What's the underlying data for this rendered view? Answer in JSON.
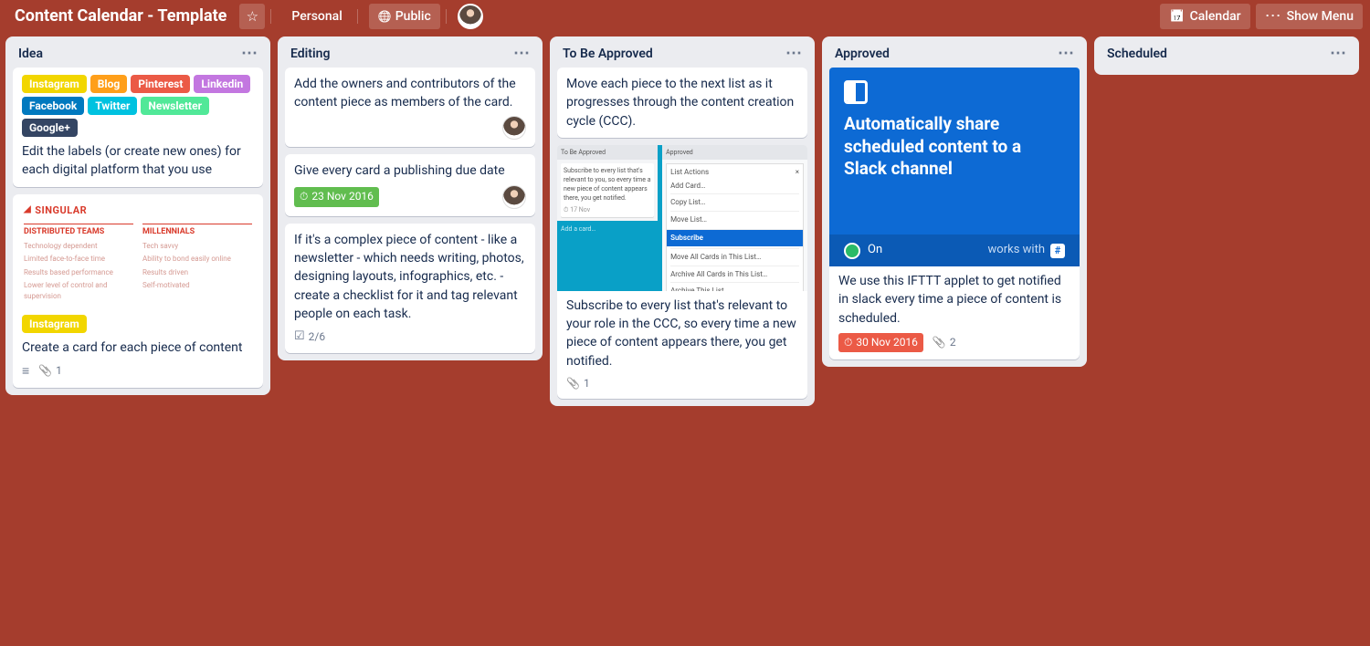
{
  "header": {
    "board_title": "Content Calendar - Template",
    "personal": "Personal",
    "public": "Public",
    "calendar": "Calendar",
    "show_menu": "Show Menu"
  },
  "label_colors": {
    "Instagram": "#f2d600",
    "Blog": "#ff9f1a",
    "Pinterest": "#eb5a46",
    "Linkedin": "#c377e0",
    "Facebook": "#0079bf",
    "Twitter": "#00c2e0",
    "Newsletter": "#51e898",
    "Google+": "#344563"
  },
  "lists": {
    "idea": {
      "title": "Idea",
      "card1": {
        "labels": [
          "Instagram",
          "Blog",
          "Pinterest",
          "Linkedin",
          "Facebook",
          "Twitter",
          "Newsletter",
          "Google+"
        ],
        "text": "Edit the labels (or create new ones) for each digital platform that you use"
      },
      "card2": {
        "cover": {
          "brand": "SINGULAR",
          "col1_head": "DISTRIBUTED TEAMS",
          "col1_lines": [
            "Technology dependent",
            "Limited face-to-face time",
            "Results based performance",
            "Lower level of control and supervision"
          ],
          "col2_head": "MILLENNIALS",
          "col2_lines": [
            "Tech savvy",
            "Ability to bond easily online",
            "Results driven",
            "Self-motivated"
          ]
        },
        "labels": [
          "Instagram"
        ],
        "text": "Create a card for each piece of content",
        "attach_count": "1"
      }
    },
    "editing": {
      "title": "Editing",
      "card1": {
        "text": "Add the owners and contributors of the content piece as members of the card."
      },
      "card2": {
        "text": "Give every card a publishing due date",
        "due": "23 Nov 2016"
      },
      "card3": {
        "text": "If it's a complex piece of content - like a newsletter - which needs writing, photos, designing layouts, infographics, etc. - create a checklist for it and tag relevant people on each task.",
        "checklist": "2/6"
      }
    },
    "tba": {
      "title": "To Be Approved",
      "card1": {
        "text": "Move each piece to the next list as it progresses through the content creation cycle (CCC)."
      },
      "card2": {
        "cover": {
          "left_header": "To Be Approved",
          "left_card_text": "Subscribe to every list that's relevant to you, so every time a new piece of content appears there, you get notified.",
          "left_date": "17 Nov",
          "left_add": "Add a card…",
          "approved": "Approved",
          "popup_title": "List Actions",
          "items": [
            "Add Card…",
            "Copy List…",
            "Move List…",
            "Subscribe",
            "Move All Cards in This List…",
            "Archive All Cards in This List…",
            "Archive This List"
          ]
        },
        "text": "Subscribe to every list that's relevant to your role in the CCC, so every time a new piece of content appears there, you get notified.",
        "attach_count": "1"
      }
    },
    "approved": {
      "title": "Approved",
      "card1": {
        "cover": {
          "title": "Automatically share scheduled content to a Slack channel",
          "on": "On",
          "works_with": "works with"
        },
        "text": "We use this IFTTT applet to get notified in slack every time a piece of content is scheduled.",
        "due": "30 Nov 2016",
        "attach_count": "2"
      }
    },
    "scheduled": {
      "title": "Scheduled"
    }
  }
}
